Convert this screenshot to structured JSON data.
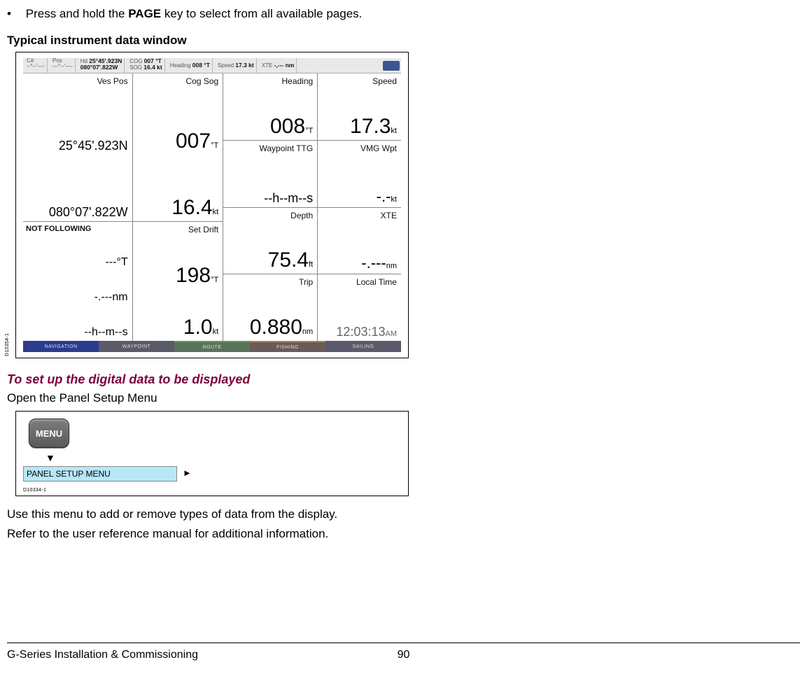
{
  "top_instruction_prefix": "Press and hold the ",
  "top_instruction_key": "PAGE",
  "top_instruction_suffix": " key to select from all available pages.",
  "section_title": "Typical instrument data window",
  "topbar": {
    "s1a": "C#",
    "s1b": "--°--'----",
    "s2a": "Pos",
    "s2b": "---°--'----",
    "s3l": "Hd",
    "s3a": "25°45'.923N",
    "s3b": "080°07'.822W",
    "s4a": "COG",
    "s4av": "007 °T",
    "s4b": "SOG",
    "s4bv": "16.4 kt",
    "s5l": "Heading",
    "s5v": "008 °T",
    "s6l": "Speed",
    "s6v": "17.3 kt",
    "s7l": "XTE",
    "s7v": "-,--- nm"
  },
  "cells": {
    "vespos_lbl": "Ves Pos",
    "vespos_v1": "25°45'.923N",
    "vespos_v2": "080°07'.822W",
    "nf_lbl": "NOT FOLLOWING",
    "nf_v1": "---°T",
    "nf_v2": "-.---nm",
    "nf_v3": "--h--m--s",
    "cogsog_lbl": "Cog Sog",
    "cogsog_v1": "007",
    "cogsog_u1": "°T",
    "cogsog_v2": "16.4",
    "cogsog_u2": "kt",
    "setdrift_lbl": "Set Drift",
    "setdrift_v1": "198",
    "setdrift_u1": "°T",
    "setdrift_v2": "1.0",
    "setdrift_u2": "kt",
    "heading_lbl": "Heading",
    "heading_v": "008",
    "heading_u": "°T",
    "wpt_lbl": "Waypoint TTG",
    "wpt_v": "--h--m--s",
    "depth_lbl": "Depth",
    "depth_v": "75.4",
    "depth_u": "ft",
    "trip_lbl": "Trip",
    "trip_v": "0.880",
    "trip_u": "nm",
    "speed_lbl": "Speed",
    "speed_v": "17.3",
    "speed_u": "kt",
    "vmg_lbl": "VMG Wpt",
    "vmg_v": "-.-",
    "vmg_u": "kt",
    "xte_lbl": "XTE",
    "xte_v": "-.---",
    "xte_u": "nm",
    "time_lbl": "Local Time",
    "time_v": "12:03:13",
    "time_u": "AM"
  },
  "bottombar": {
    "b1": "NAVIGATION",
    "b2": "WAYPOINT",
    "b3": "ROUTE",
    "b4": "FISHING",
    "b5": "SAILING"
  },
  "figcode1": "D10354-1",
  "subheading": "To set up the digital data to be displayed",
  "open_panel": "Open the Panel Setup Menu",
  "menu_btn": "MENU",
  "panel_setup": "PANEL SETUP MENU",
  "figcode2": "D10334-1",
  "trail1": "Use this menu to add or remove types of data from the display.",
  "trail2": "Refer to the user reference manual for additional information.",
  "footer_left": "G-Series Installation & Commissioning",
  "footer_page": "90"
}
